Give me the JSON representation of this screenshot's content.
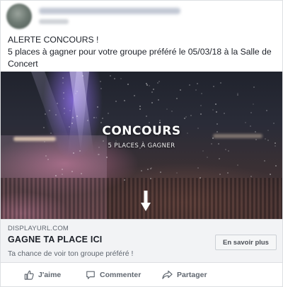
{
  "post": {
    "text_lines": [
      "ALERTE CONCOURS !",
      "5 places à gagner pour votre groupe préféré le 05/03/18 à la Salle de",
      "Concert"
    ]
  },
  "hero": {
    "title": "CONCOURS",
    "subtitle": "5 PLACES À GAGNER"
  },
  "link": {
    "display_url": "DISPLAYURL.COM",
    "title": "GAGNE TA PLACE ICI",
    "description": "Ta chance de voir ton groupe préféré !",
    "cta_label": "En savoir plus"
  },
  "actions": {
    "like_label": "J'aime",
    "comment_label": "Commenter",
    "share_label": "Partager"
  },
  "colors": {
    "text": "#1d2129",
    "secondary_text": "#606770",
    "link_box_bg": "#f2f3f5",
    "border": "#dddfe2"
  },
  "icons": [
    "avatar",
    "arrow-down-icon",
    "thumbs-up-icon",
    "comment-icon",
    "share-icon"
  ]
}
